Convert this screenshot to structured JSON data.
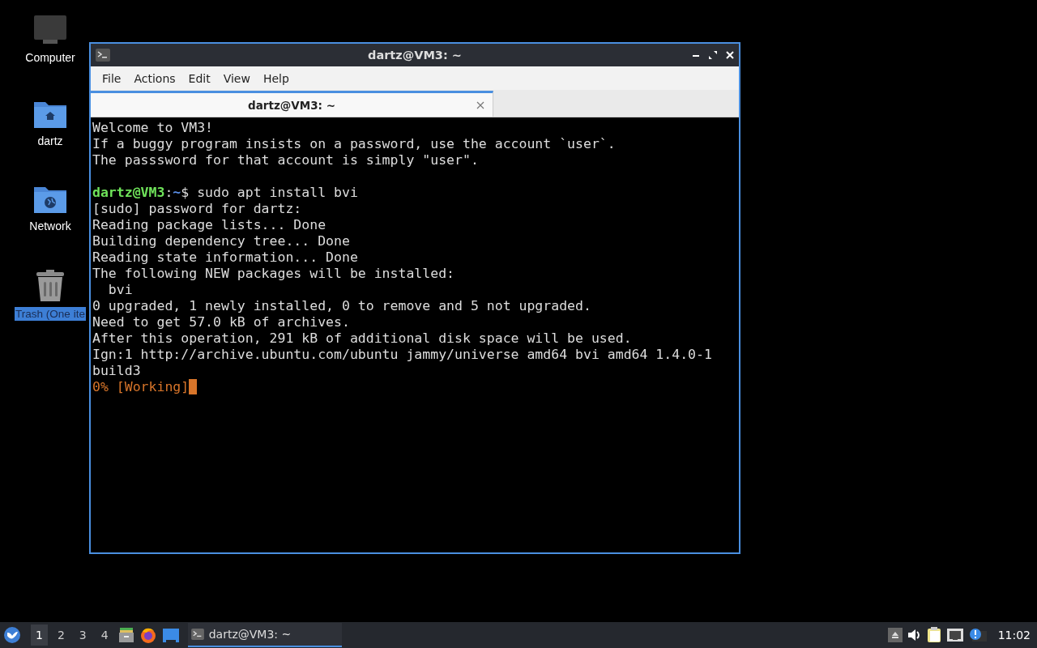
{
  "desktop_icons": [
    {
      "label": "Computer",
      "kind": "computer",
      "selected": false
    },
    {
      "label": "dartz",
      "kind": "home",
      "selected": false
    },
    {
      "label": "Network",
      "kind": "network",
      "selected": false
    },
    {
      "label": "Trash (One ite",
      "kind": "trash",
      "selected": true
    }
  ],
  "window": {
    "title": "dartz@VM3: ~",
    "menu": [
      "File",
      "Actions",
      "Edit",
      "View",
      "Help"
    ],
    "tabs": [
      {
        "label": "dartz@VM3: ~",
        "selected": true
      }
    ],
    "terminal_lines": [
      {
        "kind": "plain",
        "text": "Welcome to VM3!"
      },
      {
        "kind": "plain",
        "text": "If a buggy program insists on a password, use the account `user`."
      },
      {
        "kind": "plain",
        "text": "The passsword for that account is simply \"user\"."
      },
      {
        "kind": "blank"
      },
      {
        "kind": "prompt",
        "user": "dartz@VM3",
        "separator": ":",
        "path": "~",
        "text": "$ sudo apt install bvi"
      },
      {
        "kind": "plain",
        "text": "[sudo] password for dartz:"
      },
      {
        "kind": "plain",
        "text": "Reading package lists... Done"
      },
      {
        "kind": "plain",
        "text": "Building dependency tree... Done"
      },
      {
        "kind": "plain",
        "text": "Reading state information... Done"
      },
      {
        "kind": "plain",
        "text": "The following NEW packages will be installed:"
      },
      {
        "kind": "plain",
        "text": "  bvi"
      },
      {
        "kind": "plain",
        "text": "0 upgraded, 1 newly installed, 0 to remove and 5 not upgraded."
      },
      {
        "kind": "plain",
        "text": "Need to get 57.0 kB of archives."
      },
      {
        "kind": "plain",
        "text": "After this operation, 291 kB of additional disk space will be used."
      },
      {
        "kind": "plain",
        "text": "Ign:1 http://archive.ubuntu.com/ubuntu jammy/universe amd64 bvi amd64 1.4.0-1"
      },
      {
        "kind": "plain",
        "text": "build3"
      },
      {
        "kind": "progress",
        "text": "0% [Working]"
      }
    ]
  },
  "taskbar": {
    "workspaces": [
      {
        "label": "1",
        "selected": true
      },
      {
        "label": "2",
        "selected": false
      },
      {
        "label": "3",
        "selected": false
      },
      {
        "label": "4",
        "selected": false
      }
    ],
    "tasks": [
      {
        "label": "dartz@VM3: ~",
        "selected": true
      }
    ],
    "clock": "11:02"
  }
}
